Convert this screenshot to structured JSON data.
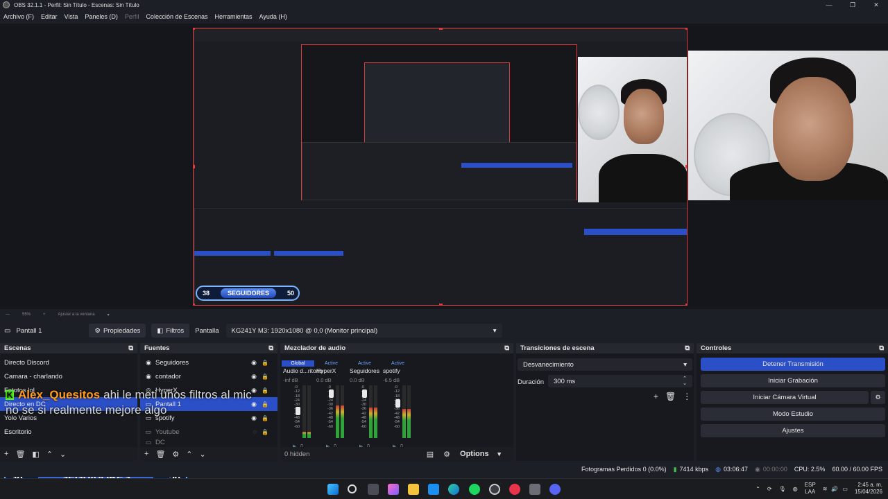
{
  "window": {
    "title": "OBS 32.1.1 - Perfil: Sin Título - Escenas: Sin Título",
    "controls": [
      "—",
      "❐",
      "✕"
    ]
  },
  "menu": [
    {
      "label": "Archivo (F)",
      "enabled": true
    },
    {
      "label": "Editar",
      "enabled": true
    },
    {
      "label": "Vista",
      "enabled": true
    },
    {
      "label": "Paneles (D)",
      "enabled": true
    },
    {
      "label": "Perfil",
      "enabled": false
    },
    {
      "label": "Colección de Escenas",
      "enabled": true
    },
    {
      "label": "Herramientas",
      "enabled": true
    },
    {
      "label": "Ayuda (H)",
      "enabled": true
    }
  ],
  "zoom": {
    "value": "55%",
    "fit_label": "Ajustar a la ventana"
  },
  "source_toolbar": {
    "source_name": "Pantall 1",
    "properties_label": "Propiedades",
    "filters_label": "Filtros",
    "display_label": "Pantalla",
    "display_value": "KG241Y M3: 1920x1080 @ 0,0 (Monitor principal)"
  },
  "scenes": {
    "title": "Escenas",
    "items": [
      {
        "label": "Directo Discord",
        "selected": false
      },
      {
        "label": "Camara - charlando",
        "selected": false
      },
      {
        "label": "Fototos lol",
        "selected": false
      },
      {
        "label": "Directo en DC",
        "selected": true
      },
      {
        "label": "Yolo Varios",
        "selected": false
      },
      {
        "label": "Escritorio",
        "selected": false
      }
    ]
  },
  "sources": {
    "title": "Fuentes",
    "items": [
      {
        "label": "Seguidores",
        "icon": "◉",
        "visible": true,
        "selected": false
      },
      {
        "label": "contador",
        "icon": "◉",
        "visible": true,
        "selected": false
      },
      {
        "label": "HyperX",
        "icon": "◎",
        "visible": true,
        "selected": false
      },
      {
        "label": "Pantall 1",
        "icon": "▭",
        "visible": true,
        "selected": true
      },
      {
        "label": "spotify",
        "icon": "▭",
        "visible": true,
        "selected": false
      },
      {
        "label": "Youtube",
        "icon": "▭",
        "visible": false,
        "selected": false
      },
      {
        "label": "DC",
        "icon": "▭",
        "visible": false,
        "selected": false
      }
    ]
  },
  "mixer": {
    "title": "Mezclador de audio",
    "channels": [
      {
        "tag": "Global",
        "name": "Audio d...ritorio",
        "db": "-inf dB",
        "level": 0.12,
        "fader": 0.55
      },
      {
        "tag": "Active",
        "name": "HyperX",
        "db": "0.0 dB",
        "level": 0.62,
        "fader": 0.92
      },
      {
        "tag": "Active",
        "name": "Seguidores",
        "db": "0.0 dB",
        "level": 0.58,
        "fader": 0.92
      },
      {
        "tag": "Active",
        "name": "spotify",
        "db": "-6.5 dB",
        "level": 0.55,
        "fader": 0.72
      }
    ],
    "scale": [
      "-0",
      "-12",
      "-18",
      "-24",
      "-30",
      "-36",
      "-42",
      "-48",
      "-54",
      "-60"
    ],
    "hidden_label": "0 hidden",
    "options_label": "Options"
  },
  "transitions": {
    "title": "Transiciones de escena",
    "selected": "Desvanecimiento",
    "duration_label": "Duración",
    "duration_value": "300 ms"
  },
  "controls": {
    "title": "Controles",
    "buttons": [
      "Detener Transmisión",
      "Iniciar Grabación",
      "Iniciar Cámara Virtual",
      "Modo Estudio",
      "Ajustes"
    ]
  },
  "status": {
    "dropped": "Fotogramas Perdidos 0 (0.0%)",
    "bitrate": "7414 kbps",
    "stream_time": "03:06:47",
    "rec_time": "00:00:00",
    "cpu": "CPU: 2.5%",
    "fps": "60.00 / 60.00 FPS"
  },
  "overlay": {
    "followers_left": "38",
    "followers_label": "SEGUIDORES",
    "followers_right": "50",
    "chat_user": "Alex_Quesitos",
    "chat_line1": "ahi le meti unos filtros al mic",
    "chat_line2": "no se si realmente mejore algo"
  },
  "taskbar": {
    "lang": "ESP",
    "region": "LAA",
    "time": "2:45 a. m.",
    "date": "15/04/2026"
  },
  "colors": {
    "accent": "#2b4fc7",
    "canvas_border": "#e23a3a",
    "kick": "#53fc18",
    "chat_user": "#ff9a1e"
  }
}
